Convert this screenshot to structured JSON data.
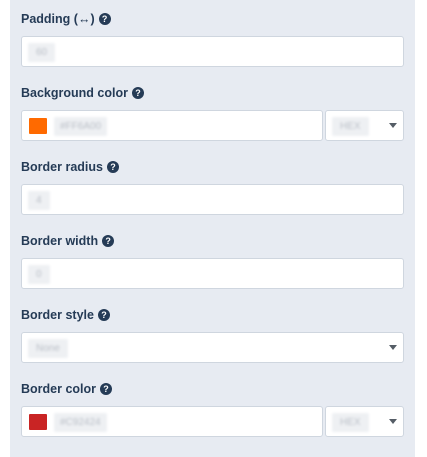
{
  "fields": {
    "padding": {
      "label": "Padding (↔)",
      "value": "60"
    },
    "background_color": {
      "label": "Background color",
      "color": "#FF6A00",
      "value": "#FF6A00",
      "format": "HEX"
    },
    "border_radius": {
      "label": "Border radius",
      "value": "4"
    },
    "border_width": {
      "label": "Border width",
      "value": "0"
    },
    "border_style": {
      "label": "Border style",
      "value": "None"
    },
    "border_color": {
      "label": "Border color",
      "color": "#C92424",
      "value": "#C92424",
      "format": "HEX"
    }
  },
  "help_glyph": "?",
  "colors": {
    "label_text": "#253b56",
    "panel_bg": "#e7ebf2"
  }
}
